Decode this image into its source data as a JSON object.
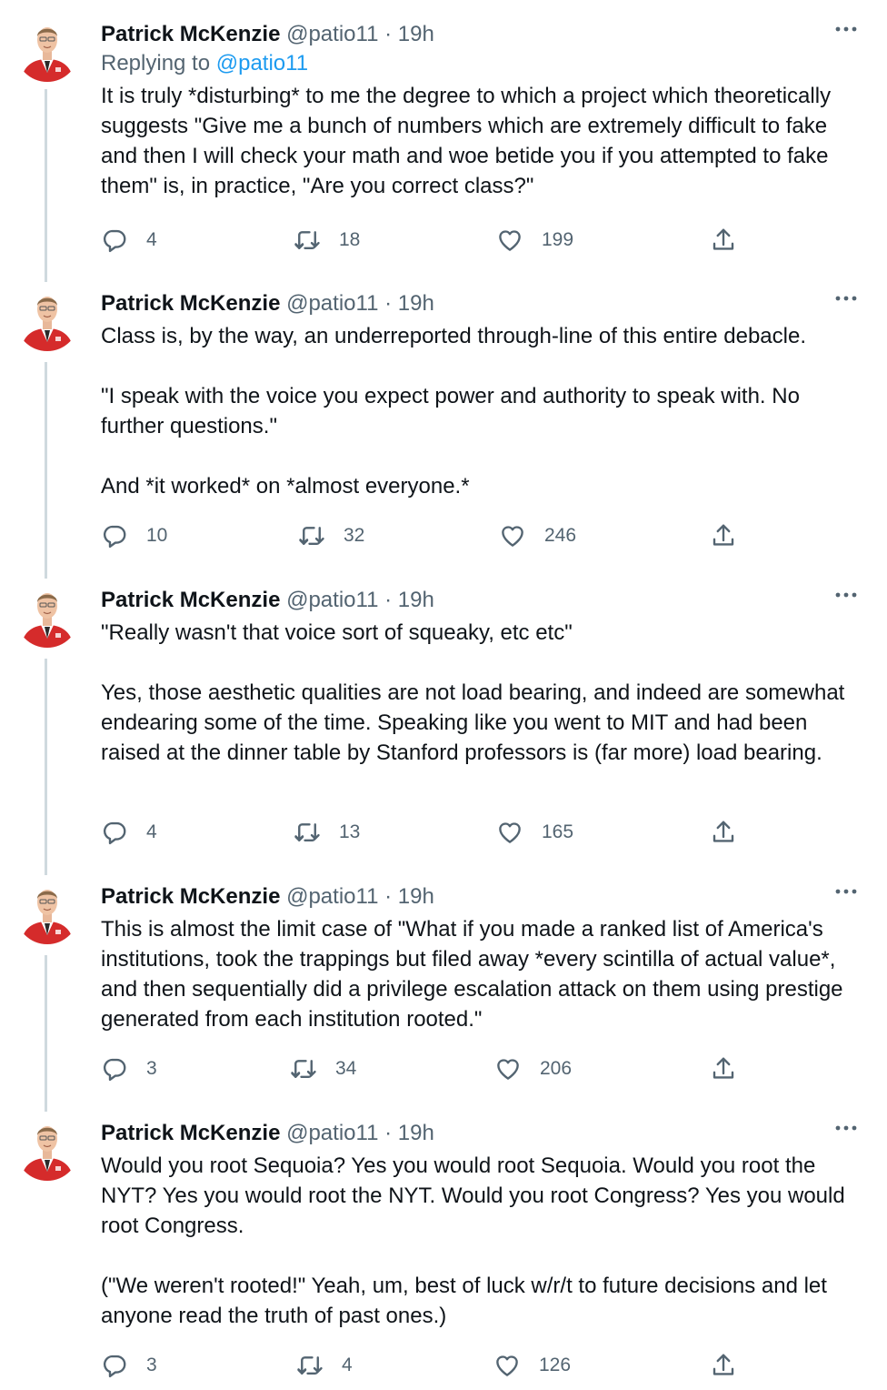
{
  "tweets": [
    {
      "name": "Patrick McKenzie",
      "handle": "@patio11",
      "time": "· 19h",
      "replying_label": "Replying to",
      "replying_handle": "@patio11",
      "text": "It is truly *disturbing* to me the degree to which a project which theoretically suggests \"Give me a bunch of numbers which are extremely difficult to fake and then I will check your math and woe betide you if you attempted to fake them\" is, in practice, \"Are you correct class?\"",
      "replies": "4",
      "retweets": "18",
      "likes": "199"
    },
    {
      "name": "Patrick McKenzie",
      "handle": "@patio11",
      "time": "· 19h",
      "text": "Class is, by the way, an underreported through-line of this entire debacle.\n\n\"I speak with the voice you expect power and authority to speak with. No further questions.\"\n\nAnd *it worked* on *almost everyone.*",
      "replies": "10",
      "retweets": "32",
      "likes": "246"
    },
    {
      "name": "Patrick McKenzie",
      "handle": "@patio11",
      "time": "· 19h",
      "text": "\"Really wasn't that voice sort of squeaky, etc etc\"\n\nYes, those aesthetic qualities are not load bearing, and indeed are somewhat endearing some of the time. Speaking like you went to MIT and had been raised at the dinner table by Stanford professors is (far more) load bearing.",
      "replies": "4",
      "retweets": "13",
      "likes": "165"
    },
    {
      "name": "Patrick McKenzie",
      "handle": "@patio11",
      "time": "· 19h",
      "text": "This is almost the limit case of \"What if you made a ranked list of America's institutions, took the trappings but filed away *every scintilla of actual value*, and then sequentially did a privilege escalation attack on them using prestige generated from each institution rooted.\"",
      "replies": "3",
      "retweets": "34",
      "likes": "206"
    },
    {
      "name": "Patrick McKenzie",
      "handle": "@patio11",
      "time": "· 19h",
      "text": "Would you root Sequoia? Yes you would root Sequoia. Would you root the NYT? Yes you would root the NYT. Would you root Congress? Yes you would root Congress.\n\n(\"We weren't rooted!\" Yeah, um, best of luck w/r/t to future decisions and let anyone read the truth of past ones.)",
      "replies": "3",
      "retweets": "4",
      "likes": "126"
    }
  ],
  "icons": {
    "avatar": "avatar-photo",
    "more": "more-icon",
    "reply": "reply-icon",
    "retweet": "retweet-icon",
    "like": "heart-icon",
    "share": "share-icon"
  },
  "colors": {
    "text": "#0f1419",
    "secondary": "#536471",
    "link": "#1d9bf0",
    "thread_line": "#cfd9de",
    "avatar_jacket": "#d52b2b"
  }
}
